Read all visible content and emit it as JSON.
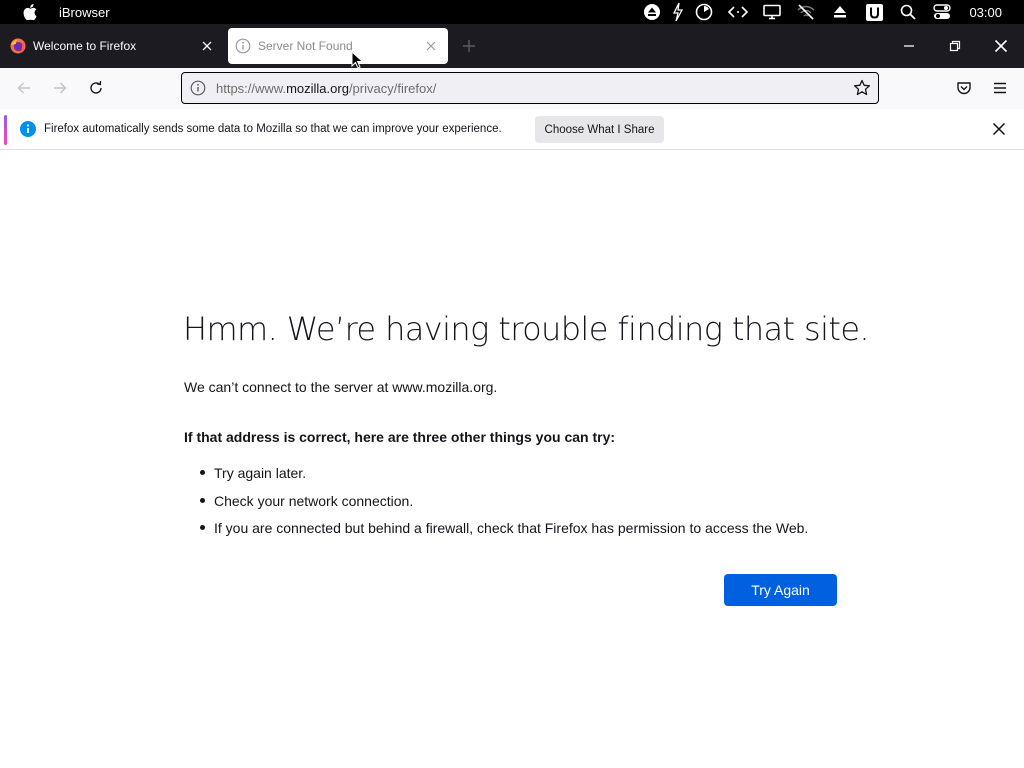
{
  "menubar": {
    "app_name": "iBrowser",
    "clock": "03:00",
    "status_icons": [
      "eject-icon",
      "bolt-icon",
      "bluetooth-icon",
      "timer-icon",
      "code-icon",
      "display-icon",
      "wifi-off-icon",
      "eject-icon",
      "u-icon",
      "search-icon",
      "control-center-icon"
    ]
  },
  "tabs": [
    {
      "title": "Welcome to Firefox",
      "icon": "firefox-icon",
      "active": false
    },
    {
      "title": "Server Not Found",
      "icon": "info-icon",
      "active": true
    }
  ],
  "urlbar": {
    "prefix": "https://www.",
    "domain": "mozilla.org",
    "suffix": "/privacy/firefox/"
  },
  "notification": {
    "text": "Firefox automatically sends some data to Mozilla so that we can improve your experience.",
    "button_label": "Choose What I Share"
  },
  "error": {
    "title": "Hmm. We’re having trouble finding that site.",
    "description": "We can’t connect to the server at www.mozilla.org.",
    "heading": "If that address is correct, here are three other things you can try:",
    "suggestions": [
      "Try again later.",
      "Check your network connection.",
      "If you are connected but behind a firewall, check that Firefox has permission to access the Web."
    ],
    "button_label": "Try Again"
  },
  "colors": {
    "accent": "#0061e0",
    "chrome_dark": "#1c1b22",
    "toolbar": "#f9f9fb"
  }
}
